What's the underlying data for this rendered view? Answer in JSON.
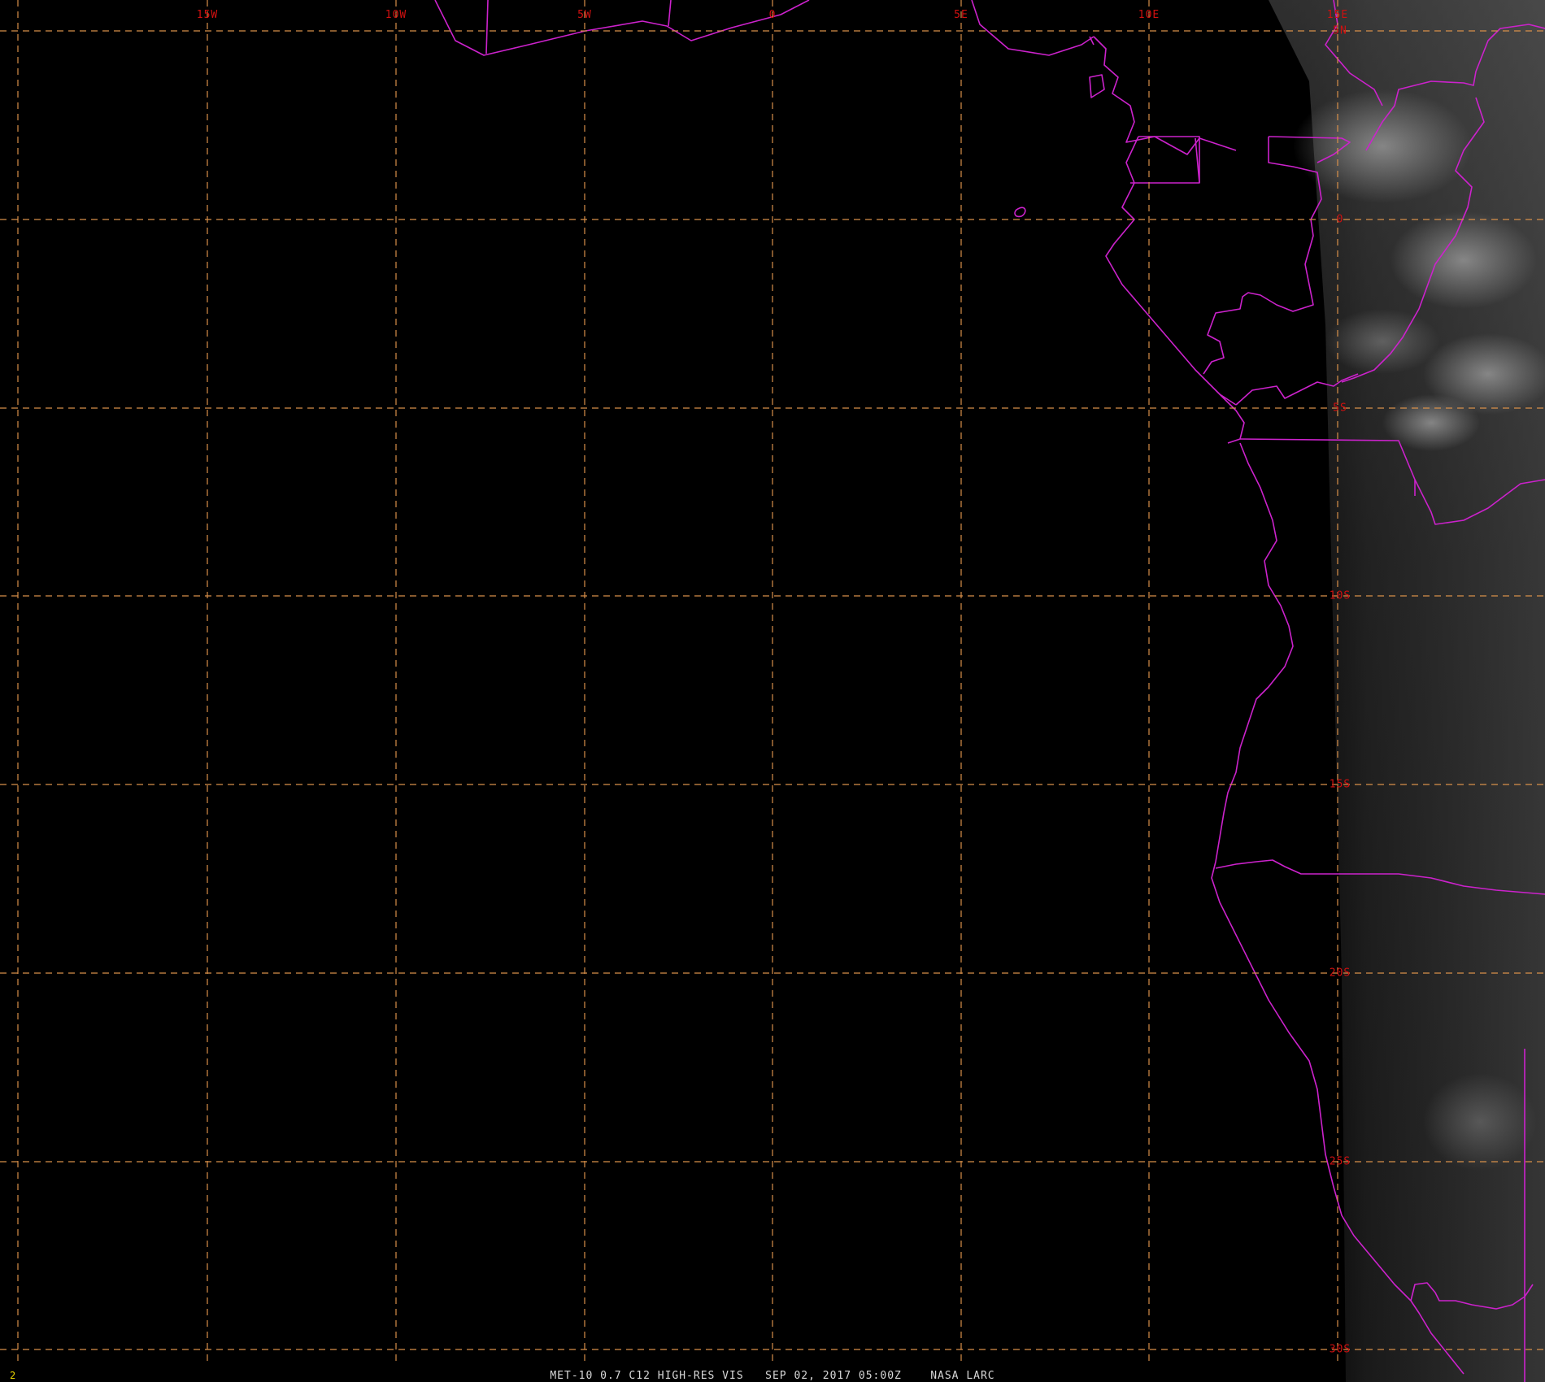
{
  "caption": {
    "satellite": "MET-10 0.7 C12 HIGH-RES VIS",
    "datetime": "SEP 02, 2017 05:00Z",
    "source": "NASA LARC"
  },
  "frame_number": "2",
  "grid": {
    "longitudes": [
      "15W",
      "10W",
      "5W",
      "0",
      "5E",
      "10E",
      "15E"
    ],
    "latitudes": [
      "5N",
      "0",
      "5S",
      "10S",
      "15S",
      "20S",
      "25S",
      "30S"
    ]
  },
  "colors": {
    "background": "#000000",
    "grid_line": "#d8904a",
    "label": "#d01010",
    "boundary": "#cc22cc",
    "caption_text": "#d8d8d8",
    "frame_number": "#e8d400"
  }
}
